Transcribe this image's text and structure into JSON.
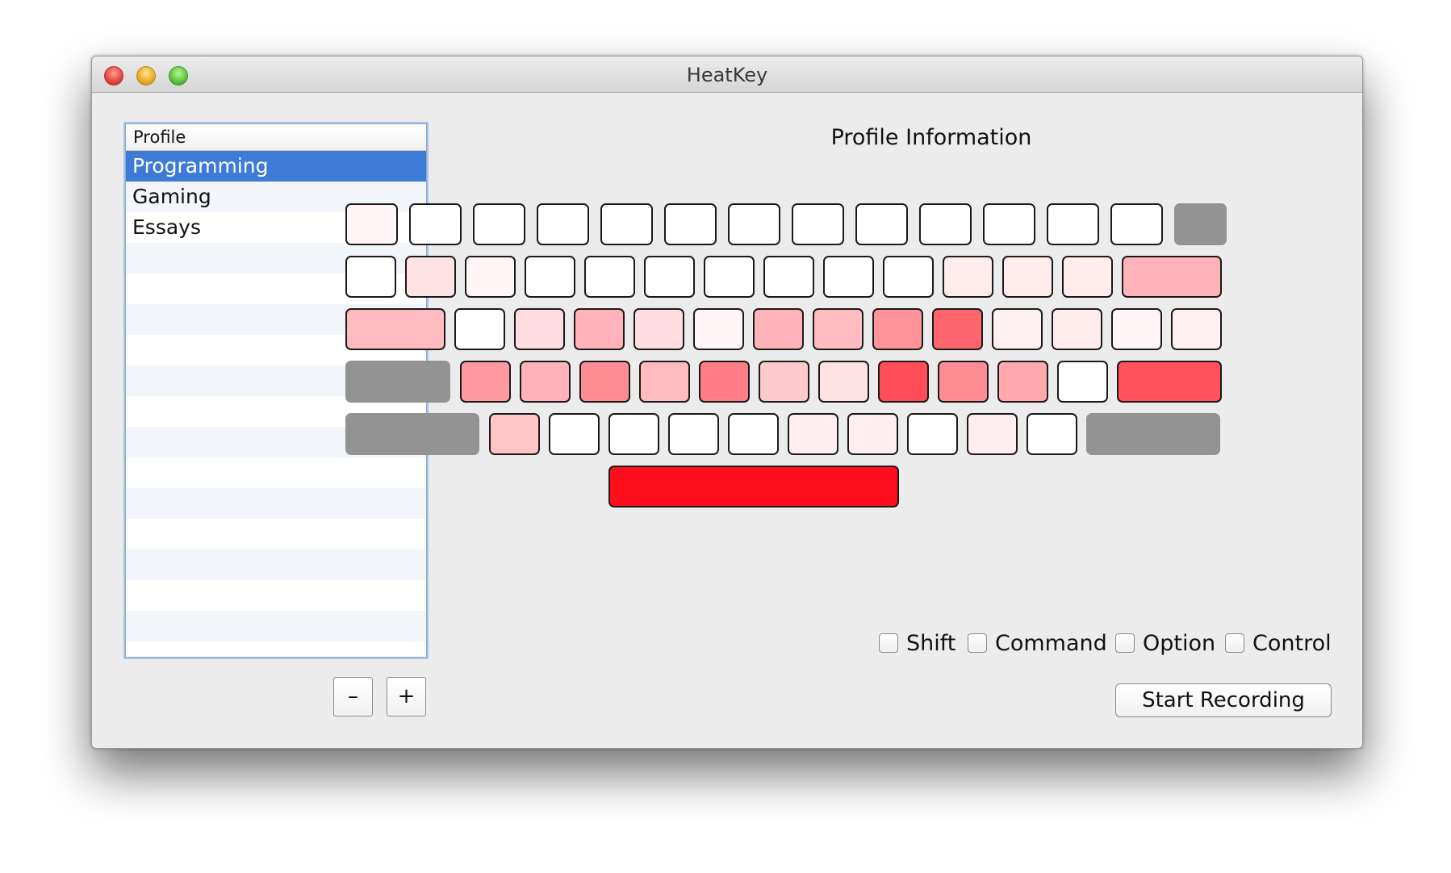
{
  "window": {
    "title": "HeatKey"
  },
  "profiles": {
    "header": "Profile",
    "items": [
      "Programming",
      "Gaming",
      "Essays"
    ],
    "selected_index": 0,
    "remove_label": "–",
    "add_label": "+"
  },
  "info": {
    "title": "Profile Information"
  },
  "keyboard_heat": {
    "scale_note_colors": {
      "none": "#ffffff",
      "max": "#ff0f1e",
      "disabled": "#939393"
    },
    "rows": [
      [
        0.04,
        0,
        0,
        0,
        0,
        0,
        0,
        0,
        0,
        0,
        0,
        0,
        0,
        null
      ],
      [
        0,
        0.12,
        0.04,
        0,
        0,
        0,
        0,
        0,
        0,
        0,
        0.08,
        0.08,
        0.08,
        0.32
      ],
      [
        0.28,
        0,
        0.14,
        0.32,
        0.14,
        0.04,
        0.32,
        0.28,
        0.45,
        0.64,
        0.06,
        0.08,
        0.04,
        0.06
      ],
      [
        null,
        0.42,
        0.32,
        0.48,
        0.28,
        0.54,
        0.22,
        0.12,
        0.74,
        0.48,
        0.36,
        0,
        0.72
      ],
      [
        null,
        0.24,
        0,
        0,
        0,
        0,
        0.07,
        0.07,
        0,
        0.07,
        0,
        null
      ],
      [
        1.0
      ]
    ]
  },
  "modifiers": [
    {
      "label": "Shift",
      "checked": false
    },
    {
      "label": "Command",
      "checked": false
    },
    {
      "label": "Option",
      "checked": false
    },
    {
      "label": "Control",
      "checked": false
    }
  ],
  "actions": {
    "record_label": "Start Recording"
  }
}
